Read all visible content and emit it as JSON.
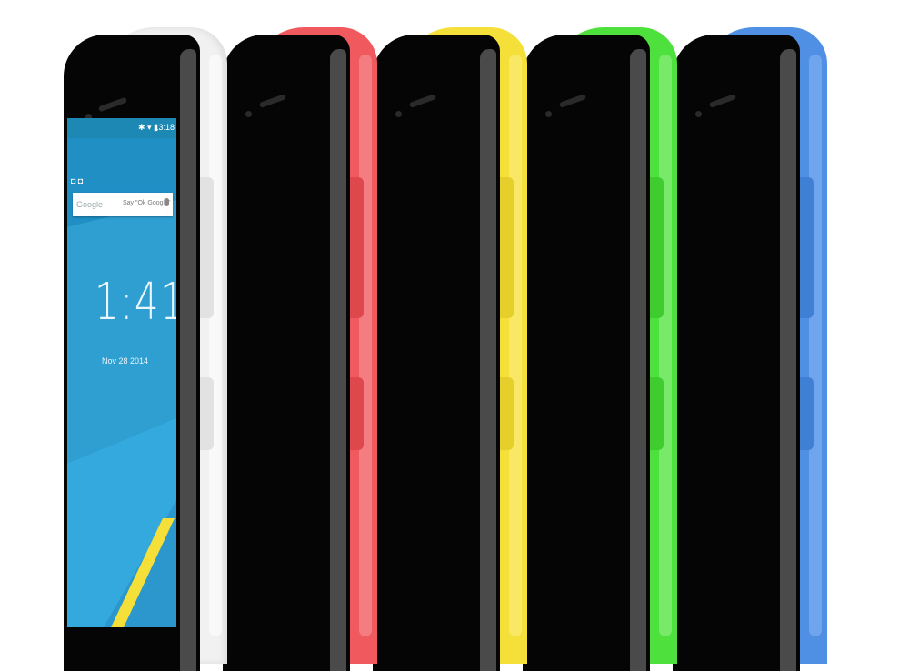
{
  "colors": {
    "white": "#f1f1f1",
    "red": "#f05a5f",
    "yellow": "#f5e03a",
    "green": "#4ee03c",
    "blue": "#4f8fe4",
    "bezel": "#050505",
    "screen": "#33a9dd",
    "accent_yellow": "#f5e03a"
  },
  "phones": [
    {
      "name": "white"
    },
    {
      "name": "red"
    },
    {
      "name": "yellow"
    },
    {
      "name": "green"
    },
    {
      "name": "blue"
    }
  ],
  "screen": {
    "status_icons": "✱ ▾ ▮",
    "status_time": "13:18",
    "notif_icons": "◘ ◘",
    "search_logo": "Google",
    "search_hint": "Say \"Ok Google\"",
    "clock": "1:41",
    "date": "Nov 28 2014"
  }
}
